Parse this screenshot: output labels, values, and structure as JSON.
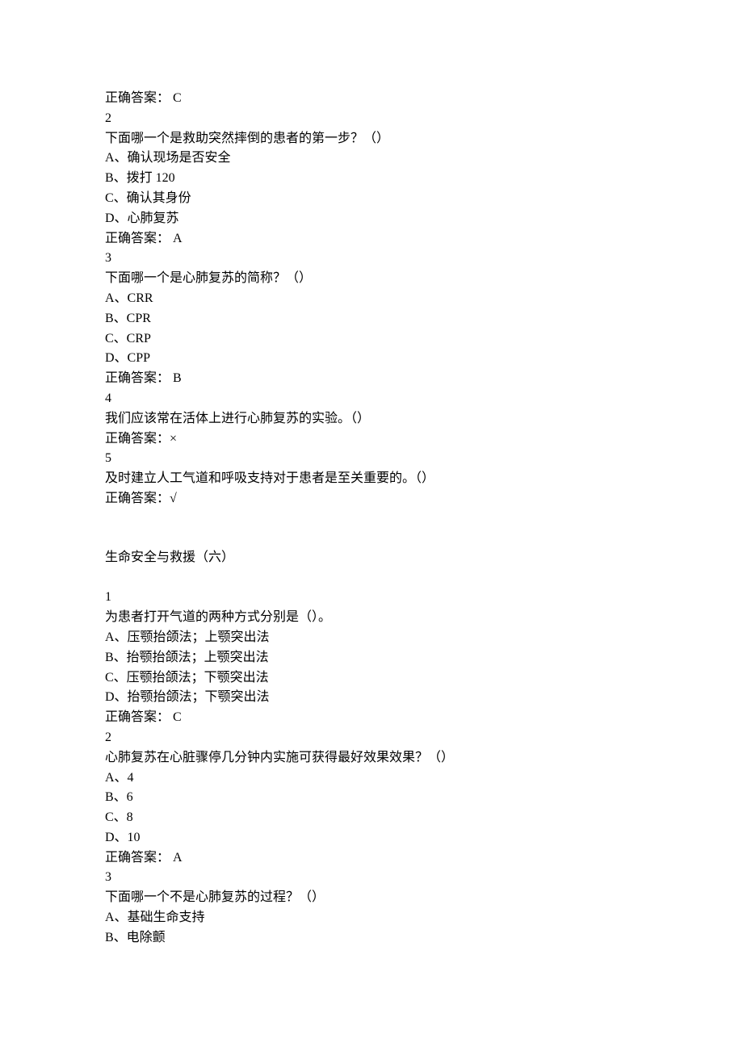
{
  "block1": {
    "prev_answer": "正确答案： C",
    "q2": {
      "num": "2",
      "stem": "下面哪一个是救助突然摔倒的患者的第一步？（）",
      "A": "A、确认现场是否安全",
      "B": "B、拨打 120",
      "C": "C、确认其身份",
      "D": "D、心肺复苏",
      "answer": "正确答案： A"
    },
    "q3": {
      "num": "3",
      "stem": "下面哪一个是心肺复苏的简称？（）",
      "A": "A、CRR",
      "B": "B、CPR",
      "C": "C、CRP",
      "D": "D、CPP",
      "answer": "正确答案： B"
    },
    "q4": {
      "num": "4",
      "stem": "我们应该常在活体上进行心肺复苏的实验。（）",
      "answer": "正确答案：×"
    },
    "q5": {
      "num": "5",
      "stem": "及时建立人工气道和呼吸支持对于患者是至关重要的。（）",
      "answer": "正确答案：√"
    }
  },
  "section_title": "生命安全与救援（六）",
  "block2": {
    "q1": {
      "num": "1",
      "stem": "为患者打开气道的两种方式分别是（）。",
      "A": "A、压颚抬颌法；上颚突出法",
      "B": "B、抬颚抬颌法；上颚突出法",
      "C": "C、压颚抬颌法；下颚突出法",
      "D": "D、抬颚抬颌法；下颚突出法",
      "answer": "正确答案： C"
    },
    "q2": {
      "num": "2",
      "stem": "心肺复苏在心脏骤停几分钟内实施可获得最好效果效果？（）",
      "A": "A、4",
      "B": "B、6",
      "C": "C、8",
      "D": "D、10",
      "answer": "正确答案： A"
    },
    "q3": {
      "num": "3",
      "stem": "下面哪一个不是心肺复苏的过程？（）",
      "A": "A、基础生命支持",
      "B": "B、电除颤"
    }
  }
}
